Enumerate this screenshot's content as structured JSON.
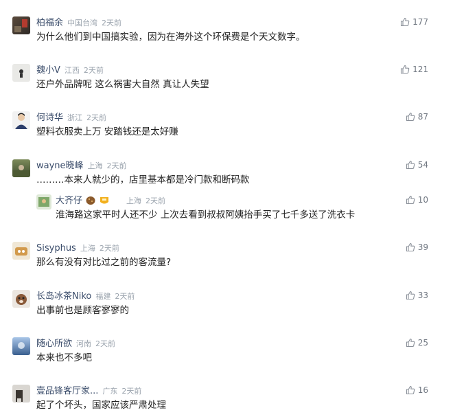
{
  "comments": [
    {
      "name": "柏福余",
      "location": "中国台湾",
      "time": "2天前",
      "text": "为什么他们到中国搞实验，因为在海外这个环保费是个天文数字。",
      "likes": "177"
    },
    {
      "name": "魏小V",
      "location": "江西",
      "time": "2天前",
      "text": "还户外品牌呢 这么祸害大自然 真让人失望",
      "likes": "121"
    },
    {
      "name": "何诗华",
      "location": "浙江",
      "time": "2天前",
      "text": "塑料衣服卖上万 安踏钱还是太好赚",
      "likes": "87"
    },
    {
      "name": "wayne晓峰",
      "location": "上海",
      "time": "2天前",
      "text": "………本来人就少的，店里基本都是冷门款和断码款",
      "likes": "54"
    },
    {
      "name": "大齐仔",
      "location": "上海",
      "time": "2天前",
      "text": "淮海路这家平时人还不少 上次去看到叔叔阿姨抬手买了七千多送了洗衣卡",
      "likes": "10"
    },
    {
      "name": "Sisyphus",
      "location": "上海",
      "time": "2天前",
      "text": "那么有没有对比过之前的客流量?",
      "likes": "39"
    },
    {
      "name": "长岛冰茶Niko",
      "location": "福建",
      "time": "2天前",
      "text": "出事前也是顾客寥寥的",
      "likes": "33"
    },
    {
      "name": "随心所欲",
      "location": "河南",
      "time": "2天前",
      "text": "本来也不多吧",
      "likes": "25"
    },
    {
      "name": "壹品锋客厅家...",
      "location": "广东",
      "time": "2天前",
      "text": "起了个坏头，国家应该严肃处理",
      "likes": "16"
    }
  ],
  "icons": {
    "like": "thumbs-up-icon"
  },
  "colors": {
    "name": "#3b4d6b",
    "meta": "#9aa3ad",
    "text": "#222222",
    "like": "#6f7680"
  }
}
